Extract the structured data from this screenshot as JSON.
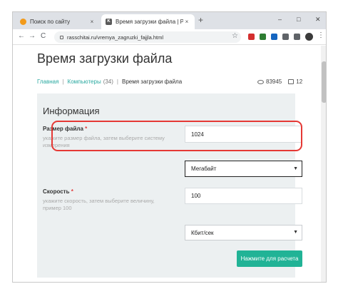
{
  "tabs": [
    {
      "label": "Поиск по сайту",
      "close": "×"
    },
    {
      "label": "Время загрузки файла | Рассчитай",
      "close": "×"
    }
  ],
  "new_tab": "+",
  "window_controls": {
    "minimize": "–",
    "maximize": "□",
    "close": "✕"
  },
  "toolbar": {
    "back": "←",
    "forward": "→",
    "reload": "C",
    "url": "rasschitai.ru/vremya_zagruzki_fajjla.html",
    "star": "☆",
    "menu": "⋮"
  },
  "extensions": [
    {
      "icon": "opera-icon",
      "color": "#d32f2f"
    },
    {
      "icon": "green-extension-icon",
      "color": "#2e7d32"
    },
    {
      "icon": "blue-extension-icon",
      "color": "#1565c0"
    },
    {
      "icon": "puzzle-icon",
      "color": "#5f6368"
    },
    {
      "icon": "playlist-icon",
      "color": "#5f6368"
    }
  ],
  "page": {
    "title": "Время загрузки файла",
    "breadcrumbs": {
      "home": "Главная",
      "category": "Компьютеры",
      "category_count": "(34)",
      "current": "Время загрузки файла"
    },
    "views": "83945",
    "comments": "12"
  },
  "panel": {
    "title": "Информация",
    "file_size": {
      "label": "Размер файла",
      "required": "*",
      "hint": "укажите размер файла, затем выберите систему измерения",
      "value": "1024",
      "unit": "Мегабайт"
    },
    "speed": {
      "label": "Скорость",
      "required": "*",
      "hint": "укажите скорость, затем выберите величину, пример 100",
      "value": "100",
      "unit": "Кбит/сек"
    },
    "submit": "Нажмите для расчета"
  }
}
